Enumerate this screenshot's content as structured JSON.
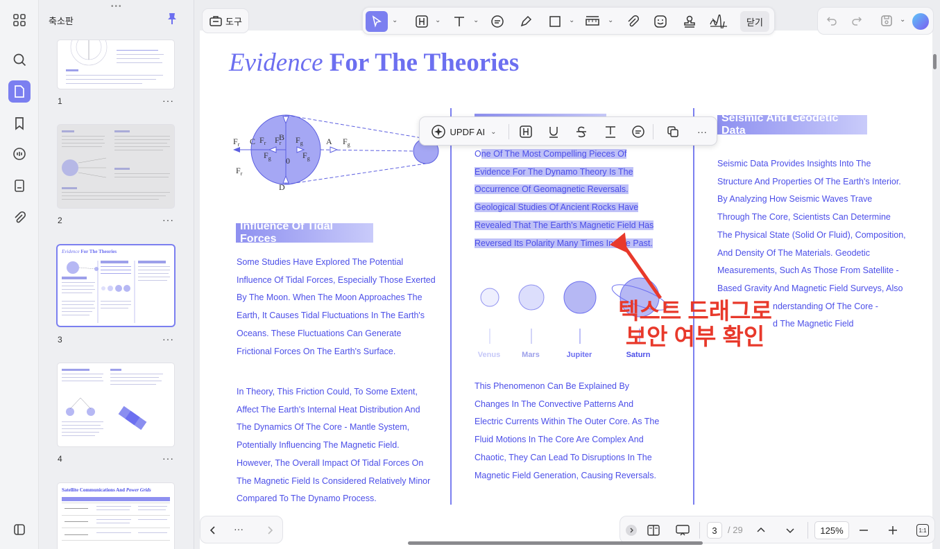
{
  "sidebar": {
    "panel_title": "축소판",
    "thumbnails": [
      {
        "number": "1"
      },
      {
        "number": "2"
      },
      {
        "number": "3"
      },
      {
        "number": "4"
      },
      {
        "number": ""
      }
    ],
    "thumb5_title_a": "Satellite Communications And ",
    "thumb5_title_b": "Power Grids",
    "thumb3_title_a": "Evidence ",
    "thumb3_title_b": "For The Theories",
    "more": "···"
  },
  "toolbar": {
    "tools_label": "도구",
    "close_label": "닫기"
  },
  "selection_popup": {
    "ai_label": "UPDF AI",
    "more": "···"
  },
  "document": {
    "title_italic": "Evidence",
    "title_bold": " For The Theories",
    "diagram": {
      "F_r": "F",
      "F_g": "F",
      "sub_r": "r",
      "sub_g": "g",
      "B": "B",
      "C": "C",
      "D": "D",
      "A": "A",
      "zero": "0"
    },
    "left": {
      "heading": "Influence Of Tidal Forces",
      "para1": "Some Studies Have Explored The Potential Influence Of Tidal Forces, Especially Those Exerted By The Moon. When The Moon Approaches The Earth, It Causes Tidal Fluctuations In The Earth's Oceans. These Fluctuations Can Generate Frictional Forces On The Earth's Surface.",
      "para2": " In Theory, This Friction Could, To Some Extent, Affect The Earth's Internal Heat Distribution And The Dynamics Of The Core - Mantle System, Potentially Influencing The Magnetic Field. However, The Overall Impact Of Tidal Forces On The Magnetic Field Is Considered Relatively Minor Compared To The Dynamo Process."
    },
    "middle": {
      "first_char": "O",
      "highlighted": "ne Of The Most Compelling Pieces Of Evidence For The Dynamo Theory Is The Occurrence Of Geomagnetic Reversals. Geological Studies Of Ancient Rocks Have Revealed That The Earth's Magnetic Field Has Reversed Its Polarity Many Times In The Past.",
      "planets": [
        "Venus",
        "Mars",
        "Jupiter",
        "Saturn"
      ],
      "para2": "This Phenomenon Can Be Explained By Changes In The Convective Patterns And Electric Currents Within The Outer Core. As The Fluid Motions In The Core Are Complex And Chaotic, They Can Lead To Disruptions In The Magnetic Field Generation, Causing Reversals."
    },
    "right": {
      "heading": "Seismic And Geodetic Data",
      "lines": [
        "Seismic Data Provides Insights Into The",
        "Structure And Properties Of The Earth's Interior.",
        "By Analyzing How Seismic Waves Trave",
        "Through The Core, Scientists Can Determine",
        "The Physical State (Solid Or Fluid), Composition,",
        "And Density Of The Materials. Geodetic",
        "Measurements, Such As Those From Satellite -",
        "Based Gravity And Magnetic Field Surveys, Also",
        "nderstanding Of The Core -",
        "d The Magnetic Field"
      ]
    }
  },
  "annotation": {
    "line1": "텍스트 드래그로",
    "line2": "보안 여부 확인",
    "color": "#e8392b"
  },
  "pagination": {
    "current": "3",
    "total": "/ 29",
    "zoom": "125%",
    "fit": "1:1",
    "more": "···"
  },
  "colors": {
    "accent": "#7b7ff0",
    "doc_text": "#4b4ee8",
    "highlight": "#bfc1f7"
  }
}
